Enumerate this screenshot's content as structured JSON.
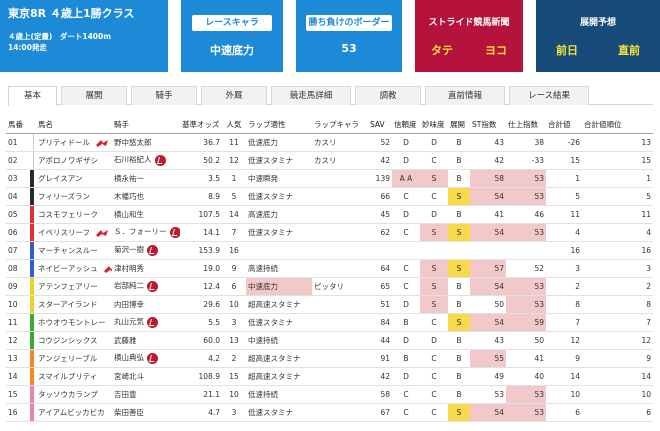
{
  "race": {
    "title": "東京8R ４歳上1勝クラス",
    "subtitle": "４歳上(定量)　ダート1400m",
    "time": "14:00発走"
  },
  "cards": {
    "chara": {
      "title": "レースキャラ",
      "value": "中速底力"
    },
    "border": {
      "title": "勝ち負けのボーダー",
      "value": "53"
    },
    "stride": {
      "title": "ストライド競馬新聞",
      "left": "タテ",
      "right": "ヨコ"
    },
    "yoso": {
      "title": "展開予想",
      "left": "前日",
      "right": "直前"
    }
  },
  "colors": {
    "accent_blue": "#1c8ad6",
    "stride_red": "#b5133b",
    "navy": "#174c7a",
    "highlight_pink": "#f2c8c8",
    "highlight_yellow": "#f7d94a"
  },
  "tabs": [
    "基本",
    "展開",
    "騎手",
    "外厩",
    "競走馬詳細",
    "調教",
    "直前情報",
    "レース結果"
  ],
  "table": {
    "headers": [
      "馬番",
      "馬名",
      "騎手",
      "基準オッズ",
      "人気",
      "ラップ適性",
      "ラップキャラ",
      "SAV",
      "信頼度",
      "妙味度",
      "展開",
      "ST指数",
      "仕上指数",
      "合計値",
      "合計値順位"
    ],
    "rows": [
      {
        "no": "01",
        "waku": "#ffffff",
        "name": "プリティドール",
        "flag": true,
        "jockey": "野中悠太郎",
        "badge": false,
        "odds": "36.7",
        "pop": "11",
        "lap": "低速底力",
        "chara": "カスリ",
        "sav": "52",
        "shin": "D",
        "myo": "D",
        "ten": "B",
        "st": "43",
        "shiage": "38",
        "goukei": "-26",
        "juni": "13"
      },
      {
        "no": "02",
        "waku": "#ffffff",
        "name": "アポロノワギザシ",
        "flag": false,
        "jockey": "石川裕紀人",
        "badge": true,
        "odds": "50.2",
        "pop": "12",
        "lap": "低速スタミナ",
        "chara": "カスリ",
        "sav": "42",
        "shin": "D",
        "myo": "C",
        "ten": "B",
        "st": "42",
        "shiage": "-33",
        "goukei": "15",
        "juni": "15"
      },
      {
        "no": "03",
        "waku": "#2a2a2a",
        "name": "グレイスアン",
        "flag": false,
        "jockey": "横永祐一",
        "badge": false,
        "odds": "3.5",
        "pop": "1",
        "lap": "中速瞬発",
        "chara": "",
        "sav": "139",
        "shin": "A A",
        "myo": "S",
        "ten": "B",
        "st": "58",
        "shiage": "53",
        "goukei": "1",
        "juni": "1"
      },
      {
        "no": "04",
        "waku": "#2a2a2a",
        "name": "フィリーズラン",
        "flag": false,
        "jockey": "木幡巧也",
        "badge": false,
        "odds": "8.9",
        "pop": "5",
        "lap": "低速スタミナ",
        "chara": "",
        "sav": "66",
        "shin": "C",
        "myo": "C",
        "ten": "S",
        "st": "54",
        "shiage": "53",
        "goukei": "5",
        "juni": "5"
      },
      {
        "no": "05",
        "waku": "#e03030",
        "name": "コスモフェリーク",
        "flag": false,
        "jockey": "横山和生",
        "badge": false,
        "odds": "107.5",
        "pop": "14",
        "lap": "高速底力",
        "chara": "",
        "sav": "45",
        "shin": "D",
        "myo": "D",
        "ten": "B",
        "st": "41",
        "shiage": "46",
        "goukei": "11",
        "juni": "11"
      },
      {
        "no": "06",
        "waku": "#e03030",
        "name": "イペリスリーフ",
        "flag": true,
        "jockey": "Ｓ．フォーリー",
        "badge": true,
        "odds": "14.1",
        "pop": "7",
        "lap": "低速スタミナ",
        "chara": "",
        "sav": "62",
        "shin": "C",
        "myo": "S",
        "ten": "S",
        "st": "54",
        "shiage": "53",
        "goukei": "4",
        "juni": "4"
      },
      {
        "no": "07",
        "waku": "#2f5fd0",
        "name": "マーチャンスルー",
        "flag": false,
        "jockey": "菊沢一樹",
        "badge": true,
        "odds": "153.9",
        "pop": "16",
        "lap": "",
        "chara": "",
        "sav": "",
        "shin": "",
        "myo": "",
        "ten": "",
        "st": "",
        "shiage": "",
        "goukei": "16",
        "juni": "16"
      },
      {
        "no": "08",
        "waku": "#2f5fd0",
        "name": "ネイビーアッシュ",
        "flag": true,
        "jockey": "津村明秀",
        "badge": false,
        "odds": "19.0",
        "pop": "9",
        "lap": "高速持続",
        "chara": "",
        "sav": "64",
        "shin": "C",
        "myo": "S",
        "ten": "S",
        "st": "57",
        "shiage": "52",
        "goukei": "3",
        "juni": "3"
      },
      {
        "no": "09",
        "waku": "#f0d020",
        "name": "アテンフェアリー",
        "flag": false,
        "jockey": "岩部純二",
        "badge": true,
        "odds": "12.4",
        "pop": "6",
        "lap": "中速底力",
        "chara": "ピッタリ",
        "sav": "65",
        "shin": "C",
        "myo": "S",
        "ten": "B",
        "st": "54",
        "shiage": "53",
        "goukei": "2",
        "juni": "2"
      },
      {
        "no": "10",
        "waku": "#f0d020",
        "name": "スターアイランド",
        "flag": false,
        "jockey": "内田博幸",
        "badge": false,
        "odds": "29.6",
        "pop": "10",
        "lap": "超高速スタミナ",
        "chara": "",
        "sav": "51",
        "shin": "D",
        "myo": "S",
        "ten": "B",
        "st": "50",
        "shiage": "53",
        "goukei": "8",
        "juni": "8"
      },
      {
        "no": "11",
        "waku": "#38a838",
        "name": "ホウオウモントレー",
        "flag": false,
        "jockey": "丸山元気",
        "badge": true,
        "odds": "5.5",
        "pop": "3",
        "lap": "低速スタミナ",
        "chara": "",
        "sav": "84",
        "shin": "B",
        "myo": "C",
        "ten": "S",
        "st": "54",
        "shiage": "59",
        "goukei": "7",
        "juni": "7"
      },
      {
        "no": "12",
        "waku": "#38a838",
        "name": "コウジンシックス",
        "flag": false,
        "jockey": "武藤雅",
        "badge": false,
        "odds": "60.0",
        "pop": "13",
        "lap": "中速持続",
        "chara": "",
        "sav": "44",
        "shin": "D",
        "myo": "D",
        "ten": "B",
        "st": "43",
        "shiage": "50",
        "goukei": "12",
        "juni": "12"
      },
      {
        "no": "13",
        "waku": "#f28a1e",
        "name": "アンジェリーブル",
        "flag": false,
        "jockey": "横山典弘",
        "badge": true,
        "odds": "4.2",
        "pop": "2",
        "lap": "超高速スタミナ",
        "chara": "",
        "sav": "91",
        "shin": "B",
        "myo": "C",
        "ten": "B",
        "st": "55",
        "shiage": "41",
        "goukei": "9",
        "juni": "9"
      },
      {
        "no": "14",
        "waku": "#f28a1e",
        "name": "スマイルプリティ",
        "flag": false,
        "jockey": "宮崎北斗",
        "badge": false,
        "odds": "108.9",
        "pop": "15",
        "lap": "超高速スタミナ",
        "chara": "",
        "sav": "42",
        "shin": "D",
        "myo": "C",
        "ten": "B",
        "st": "49",
        "shiage": "40",
        "goukei": "14",
        "juni": "14"
      },
      {
        "no": "15",
        "waku": "#f080b0",
        "name": "タッソウカランプ",
        "flag": false,
        "jockey": "吉田豊",
        "badge": false,
        "odds": "21.1",
        "pop": "10",
        "lap": "低速持続",
        "chara": "",
        "sav": "58",
        "shin": "C",
        "myo": "C",
        "ten": "B",
        "st": "53",
        "shiage": "53",
        "goukei": "10",
        "juni": "10"
      },
      {
        "no": "16",
        "waku": "#f080b0",
        "name": "アイアムビッカビカ",
        "flag": false,
        "jockey": "柴田善臣",
        "badge": false,
        "odds": "4.7",
        "pop": "3",
        "lap": "低速スタミナ",
        "chara": "",
        "sav": "67",
        "shin": "C",
        "myo": "C",
        "ten": "S",
        "st": "54",
        "shiage": "53",
        "goukei": "6",
        "juni": "6"
      }
    ]
  }
}
